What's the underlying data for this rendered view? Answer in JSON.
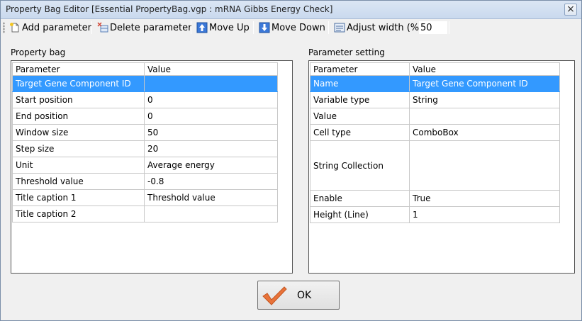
{
  "window": {
    "title": "Property Bag Editor   [Essential PropertyBag.vgp : mRNA Gibbs Energy Check]",
    "close_glyph": "×"
  },
  "toolbar": {
    "add_label": "Add parameter",
    "delete_label": "Delete parameter",
    "moveup_label": "Move Up",
    "movedown_label": "Move Down",
    "adjust_label": "Adjust width (%)",
    "adjust_value": "50"
  },
  "property_bag": {
    "label": "Property bag",
    "columns": [
      "Parameter",
      "Value"
    ],
    "rows": [
      {
        "param": "Target Gene Component ID",
        "value": ""
      },
      {
        "param": "Start position",
        "value": "0"
      },
      {
        "param": "End position",
        "value": "0"
      },
      {
        "param": "Window size",
        "value": "50"
      },
      {
        "param": "Step size",
        "value": "20"
      },
      {
        "param": "Unit",
        "value": "Average energy"
      },
      {
        "param": "Threshold value",
        "value": "-0.8"
      },
      {
        "param": "Title caption 1",
        "value": "Threshold value"
      },
      {
        "param": "Title caption 2",
        "value": ""
      }
    ]
  },
  "parameter_setting": {
    "label": "Parameter setting",
    "columns": [
      "Parameter",
      "Value"
    ],
    "rows": [
      {
        "param": "Name",
        "value": "Target Gene Component ID"
      },
      {
        "param": "Variable type",
        "value": "String"
      },
      {
        "param": "Value",
        "value": ""
      },
      {
        "param": "Cell type",
        "value": "ComboBox"
      },
      {
        "param": "String Collection",
        "value": ""
      },
      {
        "param": "Enable",
        "value": "True"
      },
      {
        "param": "Height (Line)",
        "value": "1"
      }
    ]
  },
  "ok_button": {
    "label": "OK"
  },
  "colors": {
    "selection": "#3399ff",
    "check": "#e8733a"
  }
}
